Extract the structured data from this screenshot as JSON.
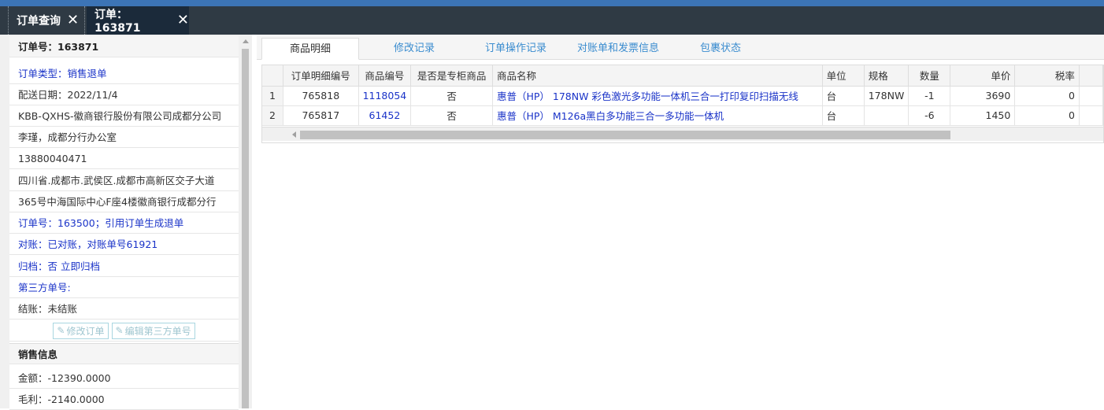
{
  "tabs": [
    {
      "label": "订单查询",
      "close": "✕"
    },
    {
      "label": "订单：163871",
      "close": "✕"
    }
  ],
  "order_info": {
    "order_no": "订单号：163871",
    "order_type": "订单类型：销售退单",
    "delivery_date": "配送日期：2022/11/4",
    "company": "KBB-QXHS-徽商银行股份有限公司成都分公司",
    "contact": "李瑾，成都分行办公室",
    "phone": "13880040471",
    "address1": "四川省.成都市.武侯区.成都市高新区交子大道",
    "address2": "365号中海国际中心F座4楼徽商银行成都分行",
    "ref_order": "订单号：163500；引用订单生成退单",
    "reconcile": "对账：已对账，对账单号61921",
    "archive": "归档：否 立即归档",
    "third_party": "第三方单号:",
    "settle": "结账：未结账",
    "btn_edit": "修改订单",
    "btn_edit_third": "编辑第三方单号"
  },
  "sales_info": {
    "title": "销售信息",
    "amount": "金额：-12390.0000",
    "profit": "毛利：-2140.0000"
  },
  "subtabs": [
    "商品明细",
    "修改记录",
    "订单操作记录",
    "对账单和发票信息",
    "包裹状态"
  ],
  "table": {
    "headers": [
      "",
      "订单明细编号",
      "商品编号",
      "是否是专柜商品",
      "商品名称",
      "单位",
      "规格",
      "数量",
      "单价",
      "税率"
    ],
    "rows": [
      [
        "1",
        "765818",
        "1118054",
        "否",
        "惠普（HP） 178NW 彩色激光多功能一体机三合一打印复印扫描无线",
        "台",
        "178NW",
        "-1",
        "3690",
        "0"
      ],
      [
        "2",
        "765817",
        "61452",
        "否",
        "惠普（HP） M126a黑白多功能三合一多功能一体机",
        "台",
        "",
        "-6",
        "1450",
        "0"
      ]
    ]
  },
  "colors": {
    "accent": "#3c74b6",
    "tabbar": "#2f3a44",
    "link": "#1a33c8"
  }
}
